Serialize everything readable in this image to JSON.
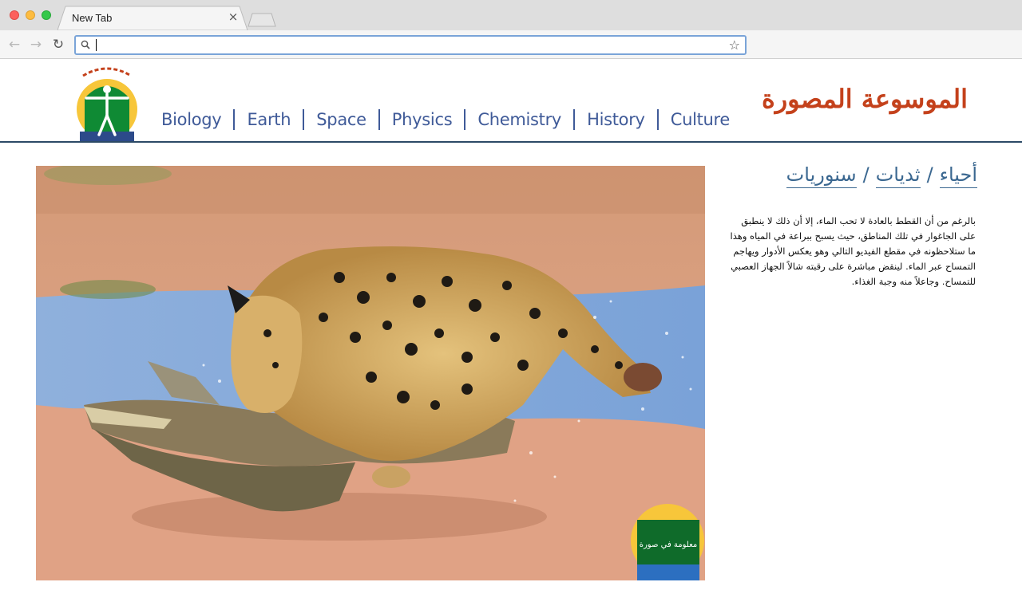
{
  "browser": {
    "tab_title": "New Tab",
    "tab_close": "×",
    "address_value": "",
    "address_placeholder": ""
  },
  "site": {
    "brand": "الموسوعة المصورة",
    "logo_text": "معلومة في صورة",
    "nav": [
      {
        "label": "Biology"
      },
      {
        "label": "Earth"
      },
      {
        "label": "Space"
      },
      {
        "label": "Physics"
      },
      {
        "label": "Chemistry"
      },
      {
        "label": "History"
      },
      {
        "label": "Culture"
      }
    ]
  },
  "breadcrumb": {
    "items": [
      "أحياء",
      "ثديات",
      "سنوريات"
    ],
    "separator": "/"
  },
  "article": {
    "text": "بالرغم من أن القطط بالعادة لا تحب الماء، إلا أن ذلك لا ينطبق على الجاغوار في تلك المناطق، حيث يسبح ببراعة في المياه وهذا ما ستلاحظونه في مقطع الفيديو التالي وهو يعكس الأدوار ويهاجم التمساح عبر الماء. لينقض مباشرة على رقبته شالاً الجهاز العصبي للتمساح. وجاعلاً منه وجبة الغذاء."
  },
  "hero_image": {
    "subject": "jaguar attacking caiman in water",
    "watermark": "معلومة في صورة"
  },
  "colors": {
    "nav": "#3f5a98",
    "brand": "#c4411b",
    "breadcrumb": "#3a6790",
    "header_rule": "#2c4a66"
  }
}
